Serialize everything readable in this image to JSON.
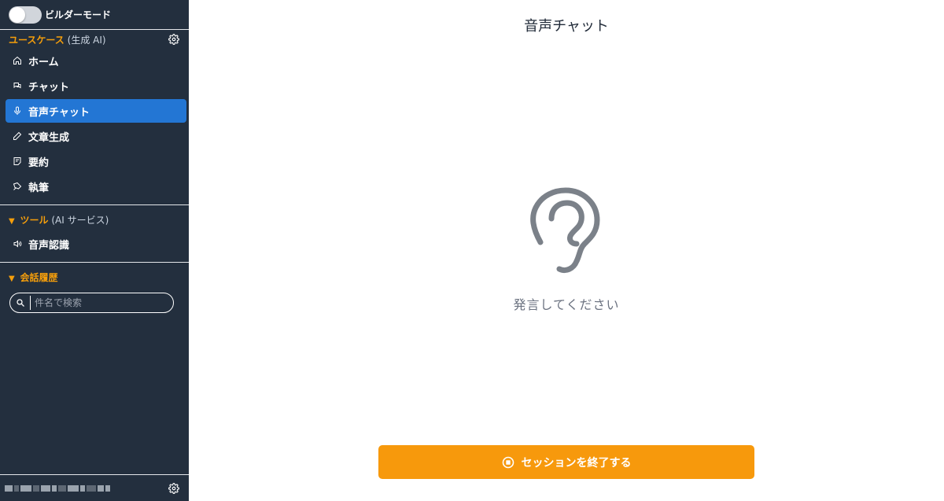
{
  "sidebar": {
    "builder_mode_label": "ビルダーモード",
    "builder_mode_on": false,
    "usecases": {
      "title": "ユースケース",
      "subtitle": "(生成 AI)"
    },
    "nav_items": [
      {
        "label": "ホーム",
        "icon": "home-icon",
        "active": false
      },
      {
        "label": "チャット",
        "icon": "chat-icon",
        "active": false
      },
      {
        "label": "音声チャット",
        "icon": "microphone-icon",
        "active": true
      },
      {
        "label": "文章生成",
        "icon": "pencil-icon",
        "active": false
      },
      {
        "label": "要約",
        "icon": "summary-icon",
        "active": false
      },
      {
        "label": "執筆",
        "icon": "pen-nib-icon",
        "active": false
      }
    ],
    "tools": {
      "title": "ツール",
      "subtitle": "(AI サービス)",
      "items": [
        {
          "label": "音声認識",
          "icon": "speaker-icon"
        }
      ]
    },
    "history": {
      "title": "会話履歴",
      "search_placeholder": "件名で検索",
      "search_value": ""
    }
  },
  "main": {
    "title": "音声チャット",
    "listening_icon": "ear-icon",
    "prompt": "発言してください",
    "end_button_label": "セッションを終了する"
  },
  "colors": {
    "sidebar_bg": "#232f3e",
    "active_bg": "#2376d4",
    "accent_orange": "#f59e0b",
    "button_orange": "#f7990c"
  }
}
